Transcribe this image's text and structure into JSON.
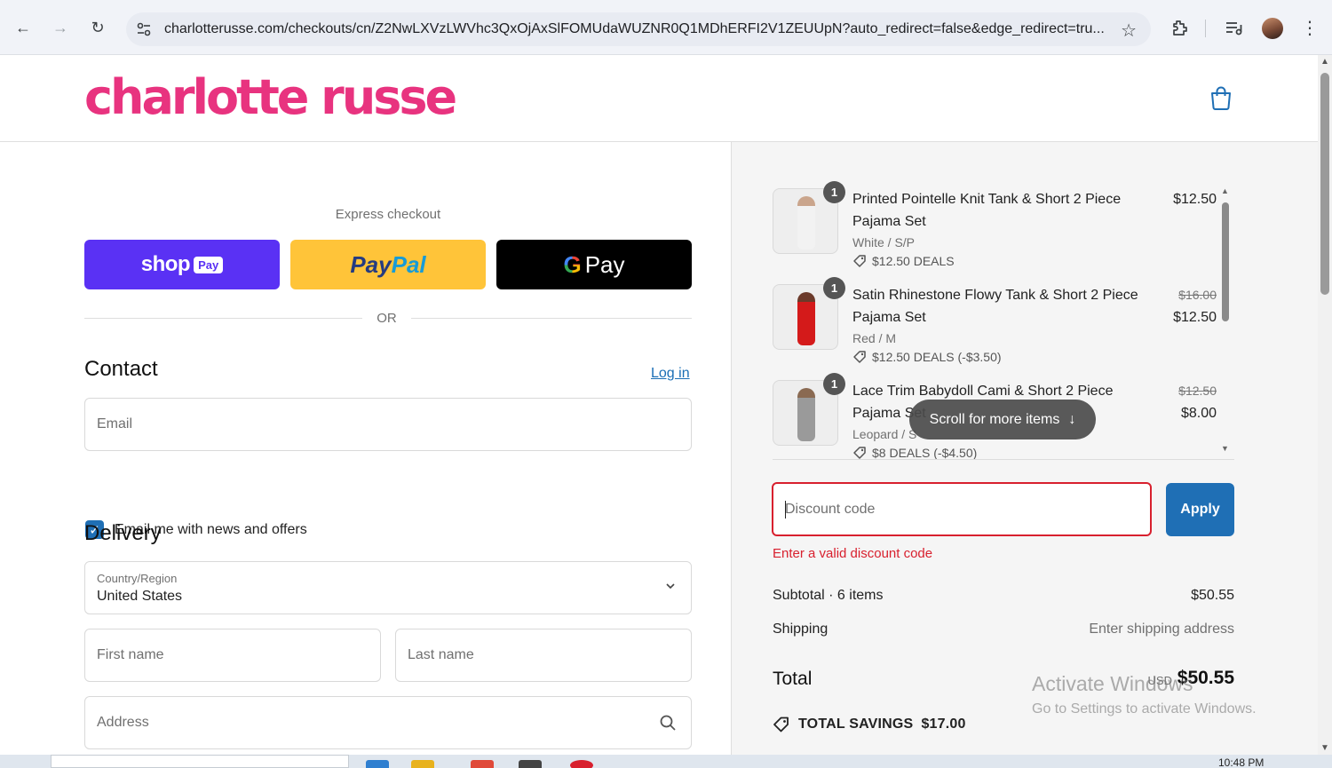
{
  "browser": {
    "url": "charlotterusse.com/checkouts/cn/Z2NwLXVzLWVhc3QxOjAxSlFOMUdaWUZNR0Q1MDhERFI2V1ZEUUpN?auto_redirect=false&edge_redirect=tru..."
  },
  "header": {
    "logo_text": "charlotte russe"
  },
  "express": {
    "label": "Express checkout",
    "shop_pay_text": "shop",
    "shop_pay_pill": "Pay",
    "paypal_part1": "Pay",
    "paypal_part2": "Pal",
    "gpay_g": "G",
    "gpay_text": "Pay",
    "or_text": "OR"
  },
  "contact": {
    "heading": "Contact",
    "login_link": "Log in",
    "email_placeholder": "Email",
    "newsletter_label": "Email me with news and offers",
    "newsletter_checked": true
  },
  "delivery": {
    "heading": "Delivery",
    "country_label": "Country/Region",
    "country_value": "United States",
    "first_name_placeholder": "First name",
    "last_name_placeholder": "Last name",
    "address_placeholder": "Address"
  },
  "cart": {
    "items": [
      {
        "quantity": "1",
        "name": "Printed Pointelle Knit Tank & Short 2 Piece Pajama Set",
        "variant": "White / S/P",
        "deal": "$12.50 DEALS",
        "original_price": "",
        "price": "$12.50"
      },
      {
        "quantity": "1",
        "name": "Satin Rhinestone Flowy Tank & Short 2 Piece Pajama Set",
        "variant": "Red / M",
        "deal": "$12.50 DEALS (-$3.50)",
        "original_price": "$16.00",
        "price": "$12.50"
      },
      {
        "quantity": "1",
        "name": "Lace Trim Babydoll Cami & Short 2 Piece Pajama Set",
        "variant": "Leopard / S",
        "deal": "$8 DEALS (-$4.50)",
        "original_price": "$12.50",
        "price": "$8.00"
      }
    ],
    "scroll_more_label": "Scroll for more items"
  },
  "discount": {
    "placeholder": "Discount code",
    "apply_label": "Apply",
    "error": "Enter a valid discount code"
  },
  "summary": {
    "subtotal_label": "Subtotal · 6 items",
    "subtotal_value": "$50.55",
    "shipping_label": "Shipping",
    "shipping_value": "Enter shipping address",
    "total_label": "Total",
    "currency": "USD",
    "total_value": "$50.55",
    "savings_label": "TOTAL SAVINGS",
    "savings_value": "$17.00"
  },
  "overlay": {
    "watermark_line1": "Activate Windows",
    "watermark_line2": "Go to Settings to activate Windows."
  },
  "taskbar": {
    "clock": "10:48 PM"
  },
  "colors": {
    "brand": "#e8337f",
    "primary_button": "#1f6fb5",
    "error": "#d8202e",
    "shop_pay": "#5a31f4",
    "paypal": "#ffc439"
  }
}
